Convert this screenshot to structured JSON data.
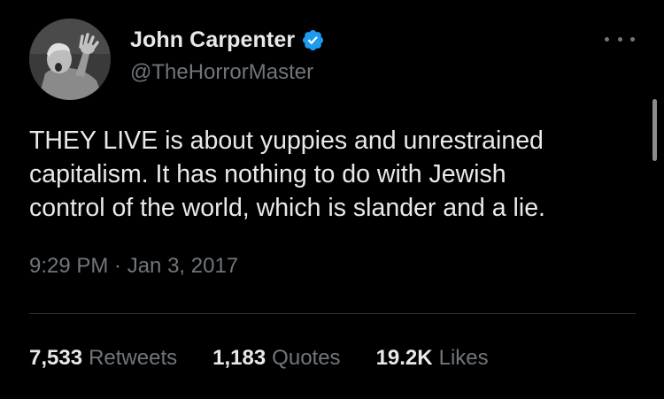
{
  "author": {
    "display_name": "John Carpenter",
    "handle": "@TheHorrorMaster",
    "verified": true,
    "verified_color": "#1d9bf0"
  },
  "tweet": {
    "lines": [
      "THEY LIVE is about yuppies and unrestrained",
      "capitalism. It has nothing to do with Jewish",
      "control of the world, which is slander and a lie."
    ],
    "timestamp": "9:29 PM · Jan 3, 2017"
  },
  "stats": [
    {
      "value": "7,533",
      "label": "Retweets"
    },
    {
      "value": "1,183",
      "label": "Quotes"
    },
    {
      "value": "19.2K",
      "label": "Likes"
    }
  ],
  "icons": {
    "more": "more-horizontal-icon",
    "verified": "verified-badge-icon"
  },
  "colors": {
    "background": "#000000",
    "primary_text": "#e7e9ea",
    "secondary_text": "#71767b",
    "divider": "#2f3336"
  }
}
